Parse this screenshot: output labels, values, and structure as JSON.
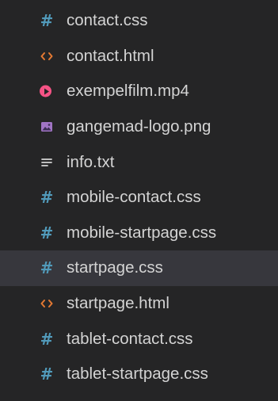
{
  "explorer": {
    "files": [
      {
        "name": "contact.css",
        "icon": "css-hash-icon",
        "color": "#519aba"
      },
      {
        "name": "contact.html",
        "icon": "html-brackets-icon",
        "color": "#e37933"
      },
      {
        "name": "exempelfilm.mp4",
        "icon": "video-play-icon",
        "color": "#f55385"
      },
      {
        "name": "gangemad-logo.png",
        "icon": "image-icon",
        "color": "#a074c4"
      },
      {
        "name": "info.txt",
        "icon": "text-lines-icon",
        "color": "#d4d4d4"
      },
      {
        "name": "mobile-contact.css",
        "icon": "css-hash-icon",
        "color": "#519aba"
      },
      {
        "name": "mobile-startpage.css",
        "icon": "css-hash-icon",
        "color": "#519aba"
      },
      {
        "name": "startpage.css",
        "icon": "css-hash-icon",
        "color": "#519aba",
        "selected": true
      },
      {
        "name": "startpage.html",
        "icon": "html-brackets-icon",
        "color": "#e37933"
      },
      {
        "name": "tablet-contact.css",
        "icon": "css-hash-icon",
        "color": "#519aba"
      },
      {
        "name": "tablet-startpage.css",
        "icon": "css-hash-icon",
        "color": "#519aba"
      }
    ]
  }
}
